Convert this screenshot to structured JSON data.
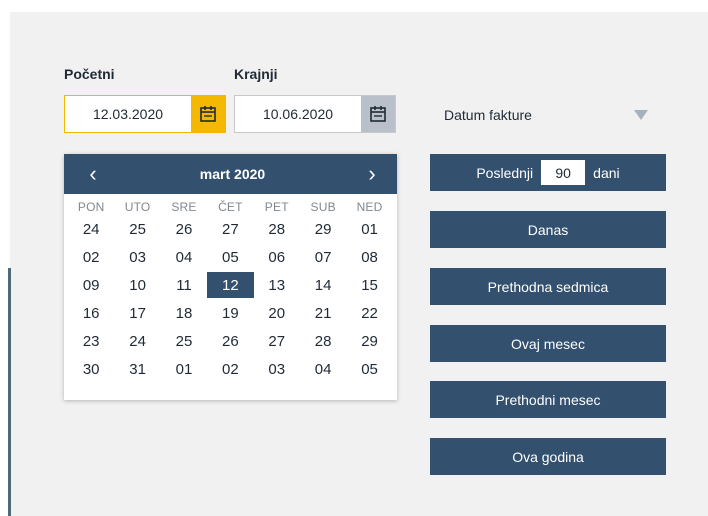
{
  "filters": {
    "start_label": "Početni",
    "end_label": "Krajnji",
    "start_value": "12.03.2020",
    "end_value": "10.06.2020",
    "date_type": "Datum fakture"
  },
  "calendar": {
    "month_title": "mart 2020",
    "prev_icon": "‹",
    "next_icon": "›",
    "weekdays": [
      "PON",
      "UTO",
      "SRE",
      "ČET",
      "PET",
      "SUB",
      "NED"
    ],
    "weeks": [
      [
        "24",
        "25",
        "26",
        "27",
        "28",
        "29",
        "01"
      ],
      [
        "02",
        "03",
        "04",
        "05",
        "06",
        "07",
        "08"
      ],
      [
        "09",
        "10",
        "11",
        "12",
        "13",
        "14",
        "15"
      ],
      [
        "16",
        "17",
        "18",
        "19",
        "20",
        "21",
        "22"
      ],
      [
        "23",
        "24",
        "25",
        "26",
        "27",
        "28",
        "29"
      ],
      [
        "30",
        "31",
        "01",
        "02",
        "03",
        "04",
        "05"
      ]
    ],
    "selected_day": "12"
  },
  "quick": {
    "last_prefix": "Poslednji",
    "last_days": "90",
    "last_suffix": "dani",
    "today": "Danas",
    "prev_week": "Prethodna sedmica",
    "this_month": "Ovaj mesec",
    "prev_month": "Prethodni mesec",
    "this_year": "Ova godina"
  },
  "colors": {
    "accent": "#f5b800",
    "primary": "#33506f",
    "panel_bg": "#f1f1f1"
  }
}
